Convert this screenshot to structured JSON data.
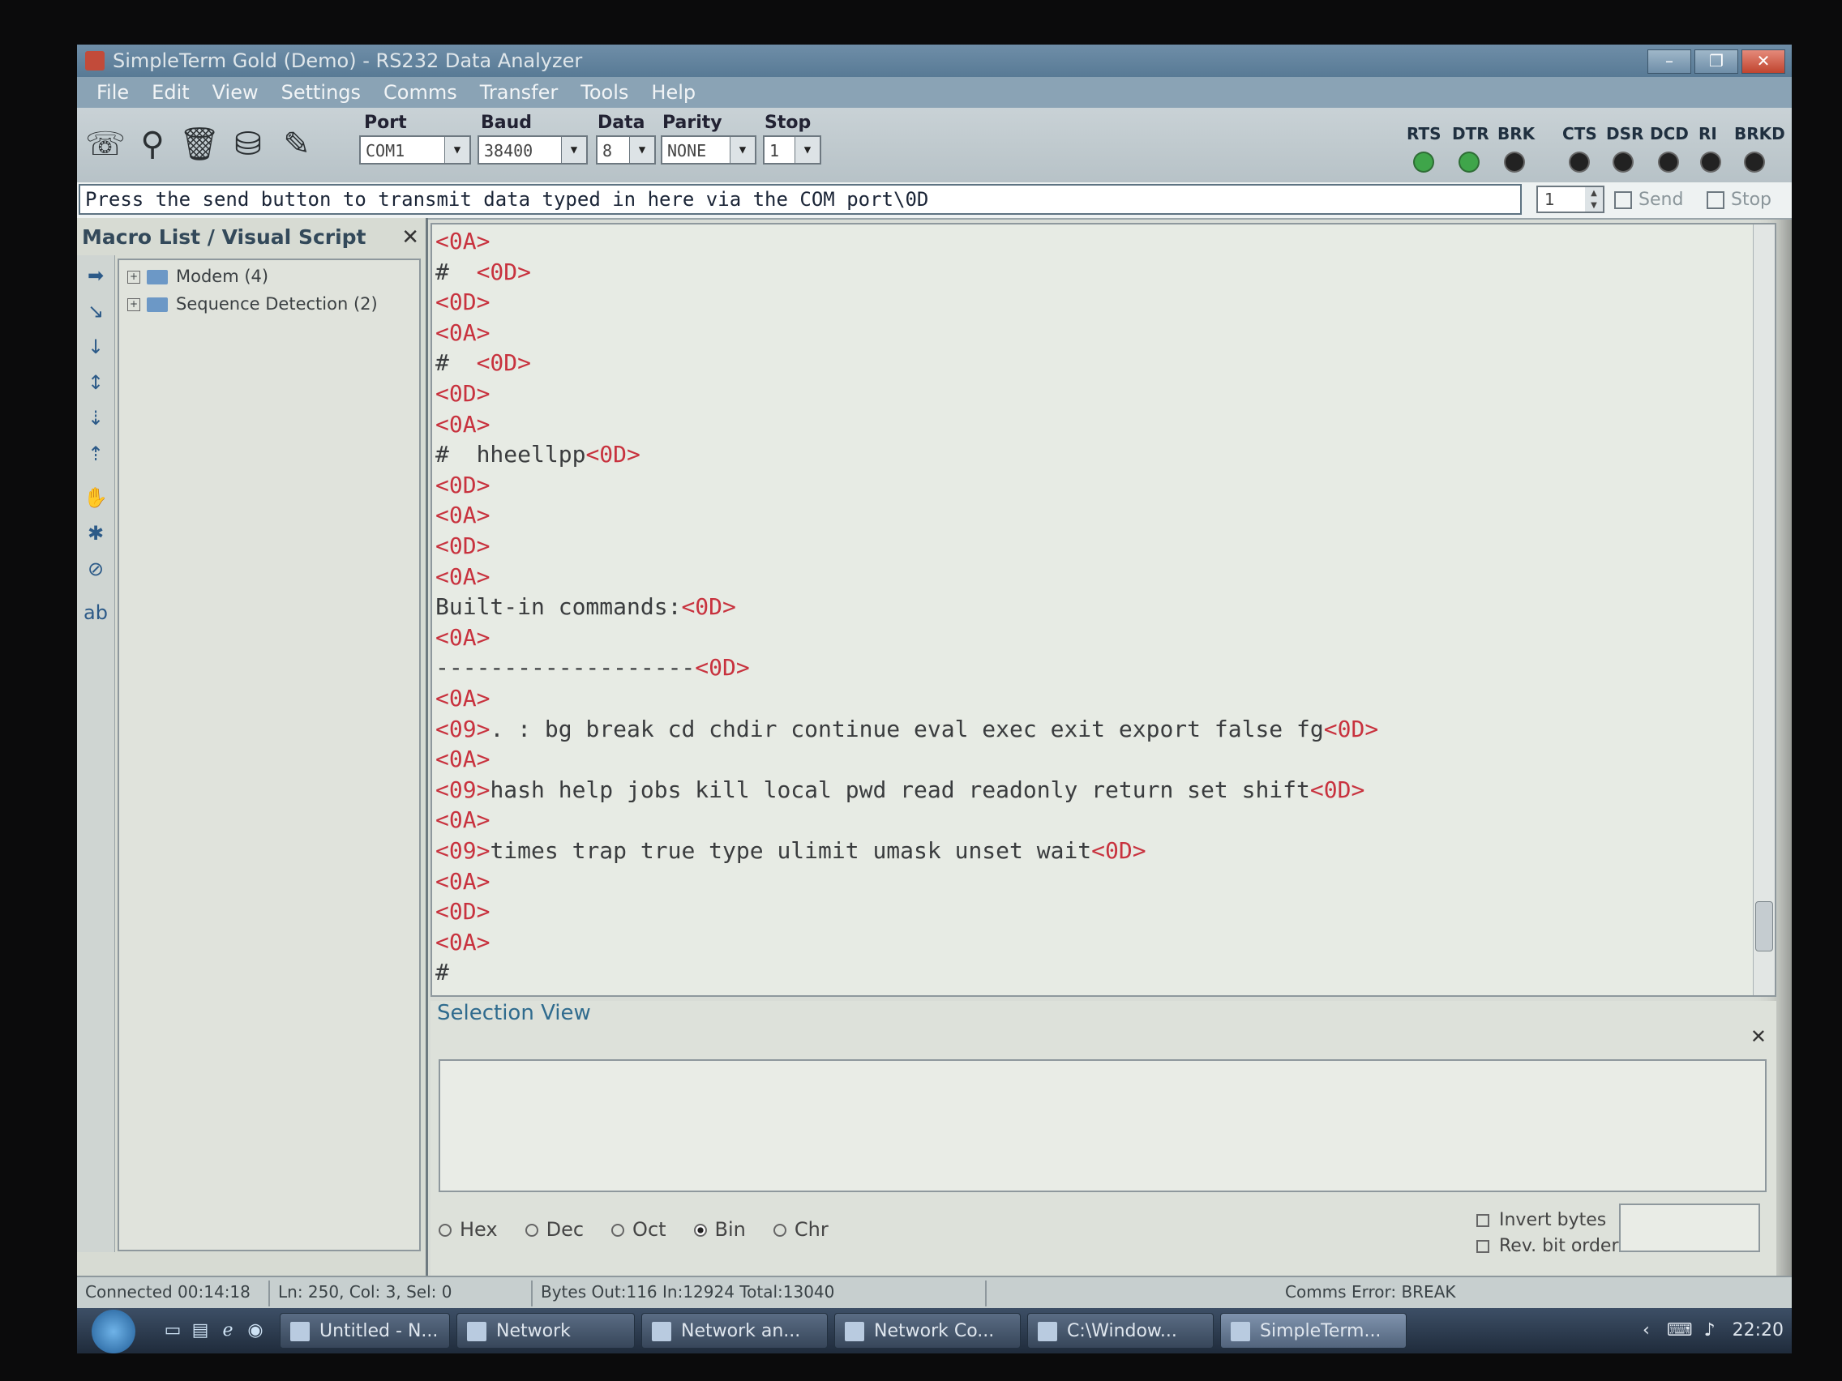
{
  "window": {
    "title": "SimpleTerm Gold (Demo) - RS232 Data Analyzer",
    "controls": [
      "–",
      "❐",
      "✕"
    ]
  },
  "menu": [
    "File",
    "Edit",
    "View",
    "Settings",
    "Comms",
    "Transfer",
    "Tools",
    "Help"
  ],
  "toolbar": {
    "port": {
      "label": "Port",
      "value": "COM1"
    },
    "baud": {
      "label": "Baud",
      "value": "38400"
    },
    "data": {
      "label": "Data",
      "value": "8"
    },
    "parity": {
      "label": "Parity",
      "value": "NONE"
    },
    "stop": {
      "label": "Stop",
      "value": "1"
    },
    "leds_out": [
      {
        "label": "RTS",
        "state": "on"
      },
      {
        "label": "DTR",
        "state": "on"
      },
      {
        "label": "BRK",
        "state": "off"
      }
    ],
    "leds_in": [
      {
        "label": "CTS",
        "state": "off"
      },
      {
        "label": "DSR",
        "state": "off"
      },
      {
        "label": "DCD",
        "state": "off"
      },
      {
        "label": "RI",
        "state": "off"
      },
      {
        "label": "BRKD",
        "state": "off"
      }
    ]
  },
  "sendbar": {
    "input_value": "Press the send button to transmit data typed in here via the COM port\\0D",
    "repeat": "1",
    "send_label": "Send",
    "stop_label": "Stop"
  },
  "macro_panel": {
    "title": "Macro List / Visual Script",
    "items": [
      {
        "label": "Modem  (4)"
      },
      {
        "label": "Sequence Detection  (2)"
      }
    ]
  },
  "terminal": {
    "lines": [
      [
        {
          "t": "<0A>",
          "c": 1
        }
      ],
      [
        {
          "t": "#  ",
          "c": 0
        },
        {
          "t": "<0D>",
          "c": 1
        }
      ],
      [
        {
          "t": "<0D>",
          "c": 1
        }
      ],
      [
        {
          "t": "<0A>",
          "c": 1
        }
      ],
      [
        {
          "t": "#  ",
          "c": 0
        },
        {
          "t": "<0D>",
          "c": 1
        }
      ],
      [
        {
          "t": "<0D>",
          "c": 1
        }
      ],
      [
        {
          "t": "<0A>",
          "c": 1
        }
      ],
      [
        {
          "t": "#  hheellpp",
          "c": 0
        },
        {
          "t": "<0D>",
          "c": 1
        }
      ],
      [
        {
          "t": "<0D>",
          "c": 1
        }
      ],
      [
        {
          "t": "<0A>",
          "c": 1
        }
      ],
      [
        {
          "t": "<0D>",
          "c": 1
        }
      ],
      [
        {
          "t": "<0A>",
          "c": 1
        }
      ],
      [
        {
          "t": "Built-in commands:",
          "c": 0
        },
        {
          "t": "<0D>",
          "c": 1
        }
      ],
      [
        {
          "t": "<0A>",
          "c": 1
        }
      ],
      [
        {
          "t": "-------------------",
          "c": 0
        },
        {
          "t": "<0D>",
          "c": 1
        }
      ],
      [
        {
          "t": "<0A>",
          "c": 1
        }
      ],
      [
        {
          "t": "<09>",
          "c": 1
        },
        {
          "t": ". : bg break cd chdir continue eval exec exit export false fg",
          "c": 0
        },
        {
          "t": "<0D>",
          "c": 1
        }
      ],
      [
        {
          "t": "<0A>",
          "c": 1
        }
      ],
      [
        {
          "t": "<09>",
          "c": 1
        },
        {
          "t": "hash help jobs kill local pwd read readonly return set shift",
          "c": 0
        },
        {
          "t": "<0D>",
          "c": 1
        }
      ],
      [
        {
          "t": "<0A>",
          "c": 1
        }
      ],
      [
        {
          "t": "<09>",
          "c": 1
        },
        {
          "t": "times trap true type ulimit umask unset wait",
          "c": 0
        },
        {
          "t": "<0D>",
          "c": 1
        }
      ],
      [
        {
          "t": "<0A>",
          "c": 1
        }
      ],
      [
        {
          "t": "<0D>",
          "c": 1
        }
      ],
      [
        {
          "t": "<0A>",
          "c": 1
        }
      ],
      [
        {
          "t": "#",
          "c": 0
        }
      ]
    ]
  },
  "selection_view": {
    "title": "Selection View",
    "formats": [
      {
        "label": "Hex",
        "selected": false
      },
      {
        "label": "Dec",
        "selected": false
      },
      {
        "label": "Oct",
        "selected": false
      },
      {
        "label": "Bin",
        "selected": true
      },
      {
        "label": "Chr",
        "selected": false
      }
    ],
    "invert_bytes": "Invert bytes",
    "rev_bit_order": "Rev. bit order"
  },
  "statusbar": {
    "connected": "Connected 00:14:18",
    "position": "Ln: 250, Col: 3, Sel: 0",
    "bytes": "Bytes Out:116  In:12924  Total:13040",
    "error": "Comms Error: BREAK"
  },
  "taskbar": {
    "tasks": [
      {
        "label": "Untitled - N...",
        "active": false
      },
      {
        "label": "Network",
        "active": false
      },
      {
        "label": "Network an...",
        "active": false
      },
      {
        "label": "Network Co...",
        "active": false
      },
      {
        "label": "C:\\Window...",
        "active": false
      },
      {
        "label": "SimpleTerm...",
        "active": true
      }
    ],
    "clock": "22:20"
  },
  "colors": {
    "control_code": "#c8323e",
    "terminal_text": "#3a3c3e",
    "led_on": "#3fa54a"
  }
}
